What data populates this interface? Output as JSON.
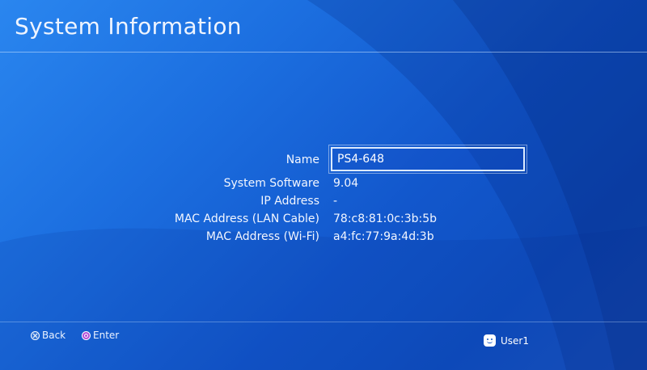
{
  "header": {
    "title": "System Information"
  },
  "info": {
    "name_label": "Name",
    "name_value": "PS4-648",
    "rows": [
      {
        "label": "System Software",
        "value": "9.04"
      },
      {
        "label": "IP Address",
        "value": "-"
      },
      {
        "label": "MAC Address (LAN Cable)",
        "value": "78:c8:81:0c:3b:5b"
      },
      {
        "label": "MAC Address (Wi-Fi)",
        "value": "a4:fc:77:9a:4d:3b"
      }
    ]
  },
  "footer": {
    "back_label": "Back",
    "back_icon": "cross-button-icon",
    "enter_label": "Enter",
    "enter_icon": "circle-button-icon",
    "user_name": "User1",
    "user_icon": "user-avatar-icon"
  },
  "colors": {
    "background": "#1c6fe0",
    "text": "#ffffff",
    "circle_button": "#b34bd6"
  }
}
